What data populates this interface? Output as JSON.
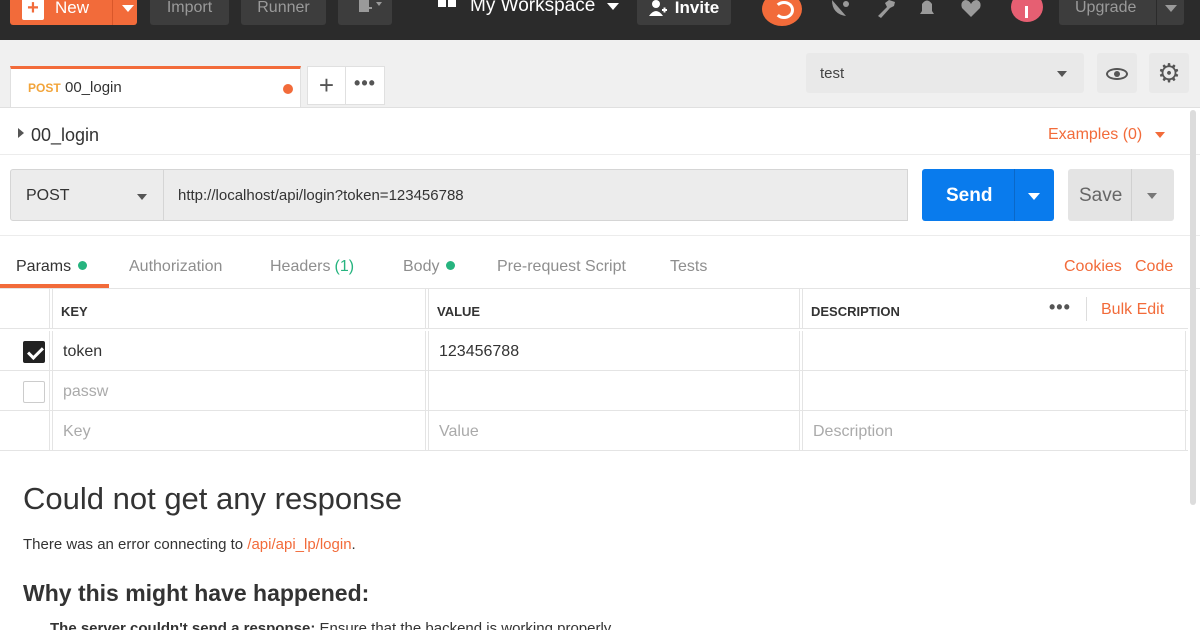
{
  "topbar": {
    "new_label": "New",
    "import_label": "Import",
    "runner_label": "Runner",
    "workspace_label": "My Workspace",
    "invite_label": "Invite",
    "upgrade_label": "Upgrade"
  },
  "tabs": [
    {
      "method": "POST",
      "name": "00_login",
      "unsaved": true
    }
  ],
  "environment": {
    "selected": "test"
  },
  "request": {
    "name": "00_login",
    "examples_label": "Examples (0)",
    "method": "POST",
    "url": "http://localhost/api/login?token=123456788",
    "send_label": "Send",
    "save_label": "Save"
  },
  "subtabs": {
    "params": "Params",
    "authorization": "Authorization",
    "headers": "Headers",
    "headers_count": "(1)",
    "body": "Body",
    "prerequest": "Pre-request Script",
    "tests": "Tests",
    "cookies": "Cookies",
    "code": "Code"
  },
  "params_table": {
    "headers": {
      "key": "KEY",
      "value": "VALUE",
      "description": "DESCRIPTION"
    },
    "bulk_edit_label": "Bulk Edit",
    "rows": [
      {
        "checked": true,
        "key": "token",
        "value": "123456788",
        "description": ""
      },
      {
        "checked": false,
        "key": "passw",
        "value": "",
        "description": ""
      }
    ],
    "placeholders": {
      "key": "Key",
      "value": "Value",
      "description": "Description"
    }
  },
  "response": {
    "title": "Could not get any response",
    "error_prefix": "There was an error connecting to ",
    "error_link": "/api/api_lp/login",
    "error_suffix": ".",
    "why_heading": "Why this might have happened:",
    "bullet_bold": "The server couldn't send a response:",
    "bullet_text": " Ensure that the backend is working properly"
  },
  "colors": {
    "accent": "#f26b3a",
    "send_blue": "#097bed",
    "status_green": "#26b47f",
    "topbar_bg": "#2b2b2b"
  }
}
